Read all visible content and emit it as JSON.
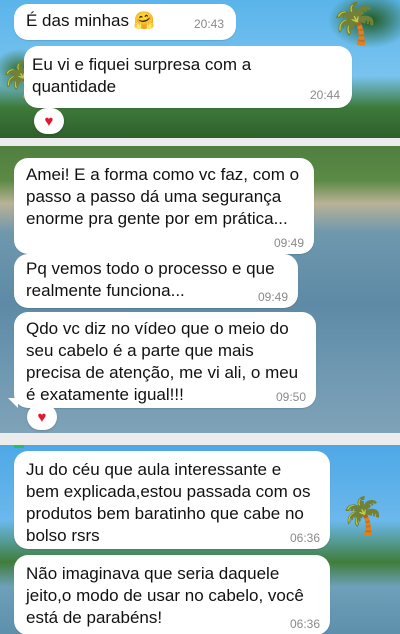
{
  "messages": [
    {
      "text": "É das minhas 🤗",
      "time": "20:43"
    },
    {
      "text": "Eu vi e fiquei surpresa com a quantidade",
      "time": "20:44",
      "reaction": "♥"
    },
    {
      "text": "Amei! E a forma como vc faz, com o passo a passo dá uma segurança enorme pra gente por em prática...",
      "time": "09:49"
    },
    {
      "text": "Pq vemos todo o processo e que realmente funciona...",
      "time": "09:49"
    },
    {
      "text": "Qdo vc diz no vídeo que o meio do seu cabelo é a parte que mais precisa de atenção, me vi ali, o meu é exatamente igual!!!",
      "time": "09:50",
      "reaction": "♥"
    },
    {
      "text": "Ju do céu que aula interessante e bem explicada,estou passada com os produtos bem baratinho que cabe no bolso rsrs",
      "time": "06:36"
    },
    {
      "text": "Não imaginava que seria daquele jeito,o modo de usar no cabelo, você está de parabéns!",
      "time": "06:36"
    }
  ],
  "colors": {
    "bubble": "#ffffff",
    "reaction": "#e0182d",
    "time": "#8a8a8a"
  }
}
